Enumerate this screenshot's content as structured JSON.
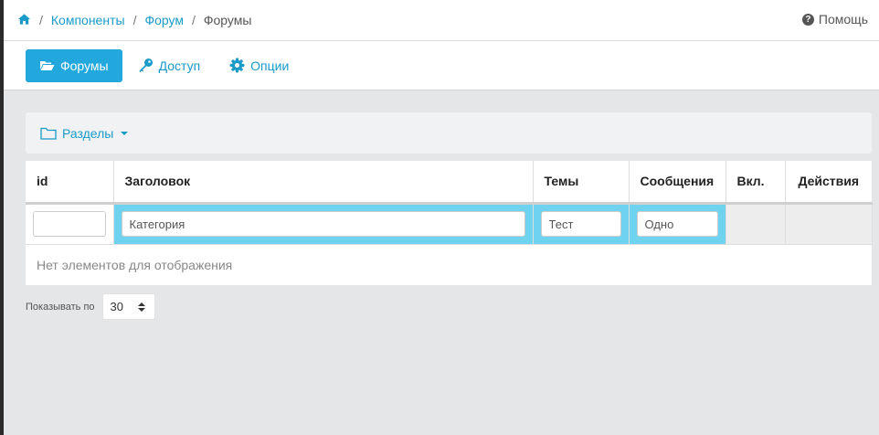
{
  "breadcrumb": {
    "home_icon": "home-icon",
    "items": [
      "Компоненты",
      "Форум"
    ],
    "current": "Форумы",
    "separator": "/"
  },
  "help": {
    "label": "Помощь",
    "icon": "question-circle-icon",
    "glyph": "?"
  },
  "tabs": [
    {
      "label": "Форумы",
      "icon": "folder-open-icon",
      "active": true
    },
    {
      "label": "Доступ",
      "icon": "key-icon",
      "active": false
    },
    {
      "label": "Опции",
      "icon": "gear-icon",
      "active": false
    }
  ],
  "sections_dropdown": {
    "label": "Разделы",
    "icon": "folder-icon"
  },
  "table": {
    "columns": [
      "id",
      "Заголовок",
      "Темы",
      "Сообщения",
      "Вкл.",
      "Действия"
    ],
    "filters": {
      "id": {
        "value": "",
        "placeholder": ""
      },
      "title": {
        "value": "",
        "placeholder": "Категория"
      },
      "topics": {
        "value": "",
        "placeholder": "Тест"
      },
      "messages": {
        "value": "",
        "placeholder": "Одно"
      }
    },
    "empty_message": "Нет элементов для отображения"
  },
  "pager": {
    "label": "Показывать по",
    "page_size": "30"
  },
  "colors": {
    "accent": "#1a9ac9",
    "active_tab": "#22a8dc",
    "filter_highlight": "#6fd3ef"
  }
}
